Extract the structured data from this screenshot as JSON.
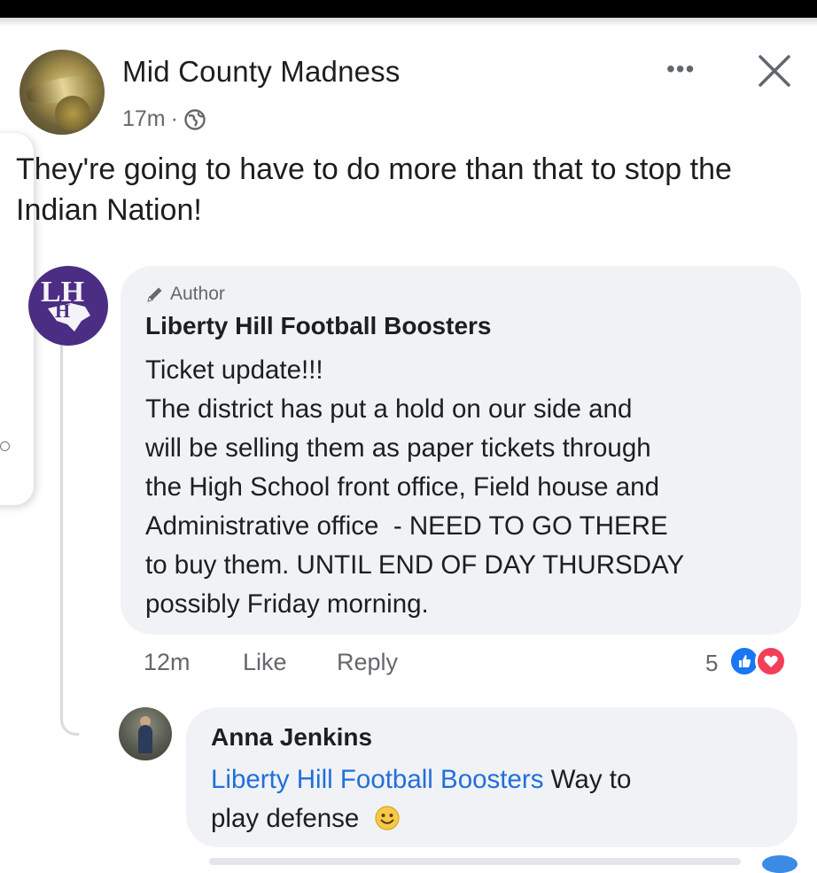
{
  "post": {
    "page_name": "Mid County Madness",
    "time": "17m",
    "separator": "·",
    "privacy_icon": "globe-icon",
    "more_label": "•••",
    "text": "They're going to have to do more than that to stop the Indian Nation!"
  },
  "comment1": {
    "badge": "Author",
    "badge_icon": "pencil-icon",
    "name": "Liberty Hill Football Boosters",
    "avatar_text": "LH",
    "text_lines": [
      "Ticket update!!!",
      "The district has put a hold on our side and",
      "will be selling them as paper tickets through",
      "the High School front office, Field house and",
      "Administrative office  - NEED TO GO THERE",
      "to buy them. UNTIL END OF DAY THURSDAY",
      "possibly Friday morning."
    ],
    "time": "12m",
    "like_label": "Like",
    "reply_label": "Reply",
    "reaction_count": "5",
    "reactions": [
      "like-icon",
      "love-icon"
    ]
  },
  "comment2": {
    "name": "Anna Jenkins",
    "mention": "Liberty Hill Football Boosters",
    "text_after_mention": " Way to",
    "text_line2": "play defense ",
    "emoji": "smile-icon"
  },
  "colors": {
    "link": "#216fdb",
    "bubble": "#f0f2f5",
    "like": "#1877f2",
    "love": "#f33e58",
    "lh_purple": "#4b2e83"
  }
}
